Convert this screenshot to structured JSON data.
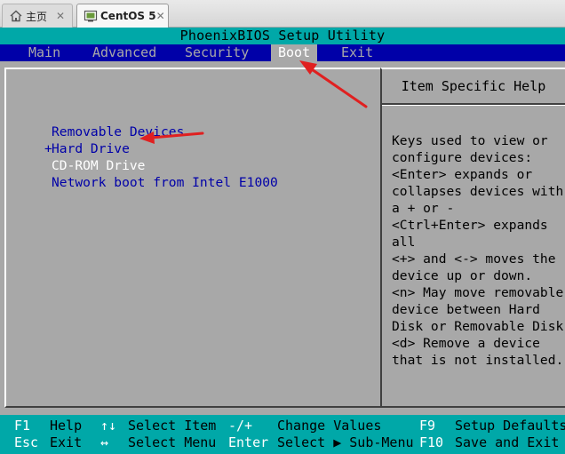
{
  "host_tabs": [
    {
      "label": "主页",
      "icon": "home-icon"
    },
    {
      "label": "CentOS 5",
      "icon": "vm-icon"
    }
  ],
  "bios": {
    "title": "PhoenixBIOS Setup Utility",
    "menu": [
      {
        "label": "Main"
      },
      {
        "label": "Advanced"
      },
      {
        "label": "Security"
      },
      {
        "label": "Boot"
      },
      {
        "label": "Exit"
      }
    ],
    "active_menu": "Boot",
    "boot_devices": [
      {
        "prefix": " ",
        "label": "Removable Devices"
      },
      {
        "prefix": "+",
        "label": "Hard Drive"
      },
      {
        "prefix": " ",
        "label": "CD-ROM Drive"
      },
      {
        "prefix": " ",
        "label": "Network boot from Intel E1000"
      }
    ],
    "selected_device": "CD-ROM Drive",
    "help_title": "Item Specific Help",
    "help_lines": [
      "Keys used to view or",
      "configure devices:",
      "<Enter> expands or",
      "collapses devices with",
      "a + or -",
      "<Ctrl+Enter> expands",
      "all",
      "<+> and <-> moves the",
      "device up or down.",
      "<n> May move removable",
      "device between Hard",
      "Disk or Removable Disk",
      "<d> Remove a device",
      "that is not installed."
    ],
    "keys_row1": [
      {
        "key": "F1",
        "desc": "Help"
      },
      {
        "key": "↑↓",
        "desc": "Select Item"
      },
      {
        "key": "-/+",
        "desc": "Change Values"
      },
      {
        "key": "F9",
        "desc": "Setup Defaults"
      }
    ],
    "keys_row2": [
      {
        "key": "Esc",
        "desc": "Exit"
      },
      {
        "key": "↔",
        "desc": "Select Menu"
      },
      {
        "key": "Enter",
        "desc": "Select ▶ Sub-Menu"
      },
      {
        "key": "F10",
        "desc": "Save and Exit"
      }
    ],
    "colors": {
      "title_bar": "#00a8a8",
      "menu_bar": "#0000a8",
      "panel_bg": "#a8a8a8",
      "item_text": "#0000a8",
      "selected_text": "#ffffff",
      "annotation": "#e02020"
    }
  }
}
